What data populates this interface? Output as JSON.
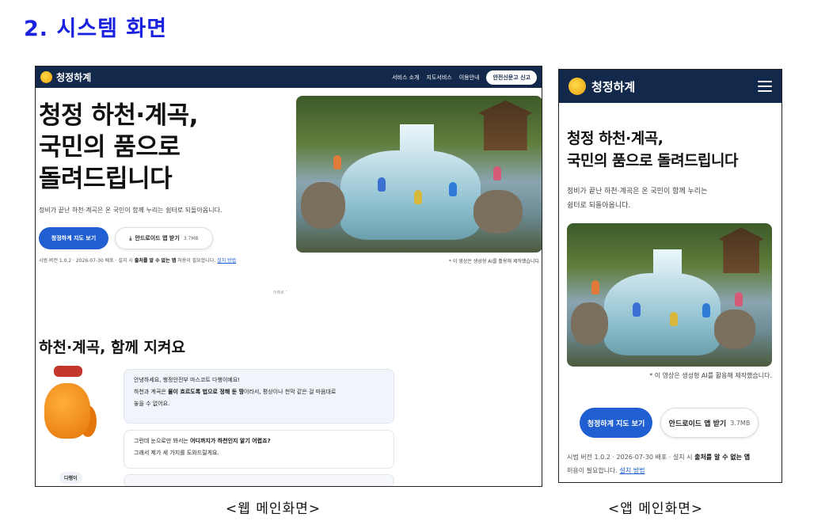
{
  "heading": "2. 시스템 화면",
  "web": {
    "logo": "청정하계",
    "menu": [
      "서비스 소개",
      "지도서비스",
      "이용안내"
    ],
    "report_button": "안전신문고 신고",
    "hero_title_line1": "청정 하천·계곡,",
    "hero_title_line2": "국민의 품으로",
    "hero_title_line3": "돌려드립니다",
    "hero_desc": "정비가 끝난 하천·계곡은 온 국민이 함께 누리는 쉼터로 되돌아옵니다.",
    "map_button": "청정하계 지도 보기",
    "download_button": "안드로이드 앱 받기",
    "download_size": "3.7MB",
    "version_prefix": "시범 버전 1.0.2 · 2026-07-30 배포 · 설치 시",
    "version_bold": "출처를 알 수 없는 앱",
    "version_suffix": "허용이 필요합니다.",
    "version_link": "설치 방법",
    "caption": "* 이 영상은 생성형 AI를 활용해 제작했습니다.",
    "scroll_hint": "아래로 ˅",
    "section_title": "하천·계곡, 함께 지켜요",
    "mascot_name": "다행이",
    "bubble1_line1": "안녕하세요, 행정안전부 마스코트 다행이예요!",
    "bubble1_line2_pre": "하천과 계곡은",
    "bubble1_line2_bold": "물이 흐르도록 법으로 정해 둔 땅",
    "bubble1_line2_post": "이라서, 평상이나 천막 같은 걸 마음대로",
    "bubble1_line3": "놓을 수 없어요.",
    "bubble2_line1_pre": "그런데 눈으로만 봐서는",
    "bubble2_line1_bold": "어디까지가 하천인지 알기 어렵죠?",
    "bubble2_line2": "그래서 제가 세 가지를 도와드릴게요."
  },
  "app": {
    "logo": "청정하계",
    "hero_title_line1": "청정 하천·계곡,",
    "hero_title_line2": "국민의 품으로 돌려드립니다",
    "hero_desc_line1": "정비가 끝난 하천·계곡은 온 국민이 함께 누리는",
    "hero_desc_line2": "쉼터로 되돌아옵니다.",
    "caption": "* 이 영상은 생성형 AI를 활용해 제작했습니다.",
    "map_button": "청정하계 지도 보기",
    "download_button": "안드로이드 앱 받기",
    "download_size": "3.7MB",
    "version_line1_pre": "시범 버전 1.0.2 · 2026-07-30 배포 · 설치 시",
    "version_bold": "출처를 알 수 없는 앱",
    "version_line2": "허용이 필요합니다.",
    "version_link": "설치 방법"
  },
  "labels": {
    "web": "<웹 메인화면>",
    "app": "<앱 메인화면>"
  },
  "colors": {
    "nav": "#13294b",
    "primary": "#1f5fd1",
    "heading": "#1a22e0"
  }
}
